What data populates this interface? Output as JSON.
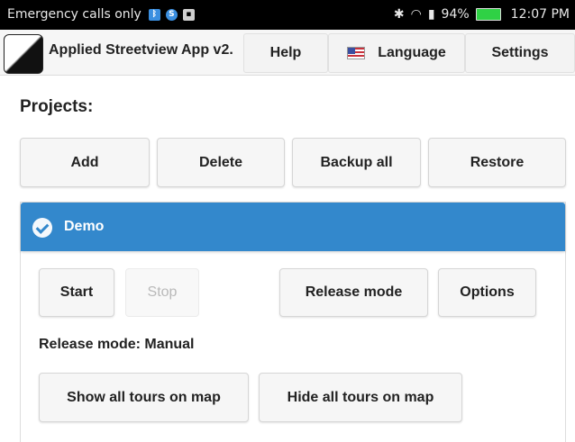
{
  "status_bar": {
    "carrier": "Emergency calls only",
    "battery": "94%",
    "time": "12:07 PM",
    "battery_color": "#2fd145"
  },
  "app": {
    "title": "Applied Streetview App v2.",
    "menu": {
      "help": "Help",
      "language": "Language",
      "settings": "Settings"
    }
  },
  "projects": {
    "heading": "Projects:",
    "buttons": {
      "add": "Add",
      "delete": "Delete",
      "backup_all": "Backup all",
      "restore": "Restore"
    }
  },
  "project": {
    "name": "Demo",
    "header_color": "#3388cc",
    "buttons": {
      "start": "Start",
      "stop": "Stop",
      "release_mode": "Release mode",
      "options": "Options",
      "show_all_tours": "Show all tours on map",
      "hide_all_tours": "Hide all tours on map"
    },
    "release_mode_text": "Release mode: Manual"
  }
}
